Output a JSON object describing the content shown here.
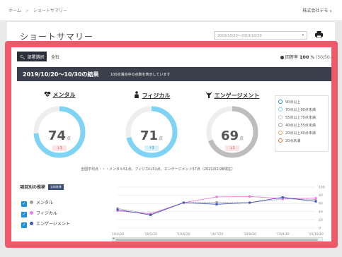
{
  "header": {
    "breadcrumb": [
      "ホーム",
      "ショートサマリー"
    ],
    "breadcrumb_sep": ">",
    "company": "株式会社デモ",
    "company_caret": "∨"
  },
  "page": {
    "title": "ショートサマリー",
    "date_range": "2019/10/20〜2019/10/30"
  },
  "tabs": {
    "department_select": "部署選択",
    "all": "全社"
  },
  "answer_rate": {
    "label": "回答率",
    "value": "100",
    "unit": "%",
    "detail": "(50/50人)"
  },
  "result": {
    "title": "2019/10/20〜10/30の結果",
    "note": "100点満点中の点数を表示しています"
  },
  "scores": [
    {
      "label": "メンタル",
      "icon": "heartbeat-icon",
      "value": "74",
      "unit": "点",
      "delta_text": "↓3",
      "direction": "down",
      "ratio": 0.74,
      "color": "#7fd3f4"
    },
    {
      "label": "フィジカル",
      "icon": "person-icon",
      "value": "71",
      "unit": "点",
      "delta_text": "↑3",
      "direction": "up",
      "ratio": 0.71,
      "color": "#7fd3f4"
    },
    {
      "label": "エンゲージメント",
      "icon": "engagement-icon",
      "value": "69",
      "unit": "点",
      "delta_text": "↓1",
      "direction": "down",
      "ratio": 0.69,
      "color": "#bdbdbd"
    }
  ],
  "legend": [
    {
      "label": "90点以上",
      "color": "#1e8fd8"
    },
    {
      "label": "70点以上90点未満",
      "color": "#7fd3f4"
    },
    {
      "label": "55点以上70点未満",
      "color": "#c8c8c8"
    },
    {
      "label": "40点以上55点未満",
      "color": "#9e9e9e"
    },
    {
      "label": "20点以上40点未満",
      "color": "#f2a268"
    },
    {
      "label": "20点未満",
      "color": "#e06b3b"
    }
  ],
  "footnote": "全国平均点・・・メンタル51点、フィジカル51点、エンゲージメント57点（2021/02/28現在）",
  "trend": {
    "title": "項目別の推移",
    "badge": "全体推移"
  },
  "series_toggles": [
    {
      "label": "メンタル",
      "color": "#9b9b9b",
      "checked": true
    },
    {
      "label": "フィジカル",
      "color": "#f07ce0",
      "checked": true
    },
    {
      "label": "エンゲージメント",
      "color": "#3f55b5",
      "checked": true
    }
  ],
  "chart_data": {
    "type": "line",
    "x": [
      "'19/4/20",
      "'19/5/20",
      "'19/6/20",
      "'19/7/20",
      "'19/8/20",
      "'19/9/20",
      "'19/10/20"
    ],
    "ylim": [
      0,
      100
    ],
    "yticks": [
      0,
      20,
      40,
      60,
      80,
      100
    ],
    "series": [
      {
        "name": "メンタル",
        "color": "#9b9b9b",
        "values": [
          48,
          34,
          62,
          63,
          62,
          71,
          70
        ]
      },
      {
        "name": "フィジカル",
        "color": "#f07ce0",
        "values": [
          42,
          35,
          62,
          76,
          77,
          72,
          73
        ]
      },
      {
        "name": "エンゲージメント",
        "color": "#3f55b5",
        "values": [
          45,
          32,
          62,
          58,
          62,
          75,
          65
        ]
      }
    ],
    "grid": true
  }
}
